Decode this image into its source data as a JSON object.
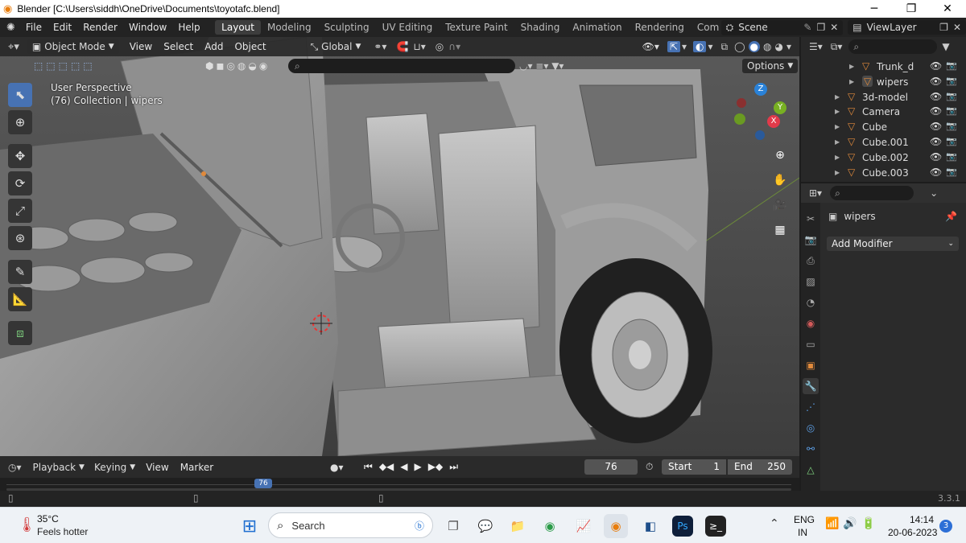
{
  "window": {
    "title": "Blender [C:\\Users\\siddh\\OneDrive\\Documents\\toyotafc.blend]",
    "minimize": "─",
    "maximize": "❐",
    "close": "✕"
  },
  "menu": {
    "items": [
      "File",
      "Edit",
      "Render",
      "Window",
      "Help"
    ]
  },
  "workspaces": [
    "Layout",
    "Modeling",
    "Sculpting",
    "UV Editing",
    "Texture Paint",
    "Shading",
    "Animation",
    "Rendering",
    "Compo"
  ],
  "scene": {
    "label": "Scene",
    "view_layer": "ViewLayer"
  },
  "viewport_header": {
    "mode": "Object Mode",
    "menus": [
      "View",
      "Select",
      "Add",
      "Object"
    ],
    "transform_orientation": "Global",
    "options": "Options"
  },
  "viewport_info": {
    "line1": "User Perspective",
    "line2": "(76) Collection | wipers"
  },
  "gizmo": {
    "z": "Z",
    "y": "Y",
    "x": "X"
  },
  "timeline": {
    "playback": "Playback",
    "keying": "Keying",
    "view": "View",
    "marker": "Marker",
    "current_frame": "76",
    "start_label": "Start",
    "start": "1",
    "end_label": "End",
    "end": "250"
  },
  "scrubber": {
    "current": "76"
  },
  "outliner": {
    "items": [
      {
        "label": "Trunk_dc",
        "depth": 1,
        "visible": true
      },
      {
        "label": "wipers",
        "depth": 1,
        "visible": true,
        "selected": true
      },
      {
        "label": "3d-model",
        "depth": 0,
        "visible": true
      },
      {
        "label": "Camera",
        "depth": 0,
        "visible": true
      },
      {
        "label": "Cube",
        "depth": 0,
        "visible": true
      },
      {
        "label": "Cube.001",
        "depth": 0,
        "visible": true
      },
      {
        "label": "Cube.002",
        "depth": 0,
        "visible": true
      },
      {
        "label": "Cube.003",
        "depth": 0,
        "visible": true
      }
    ]
  },
  "properties": {
    "object_name": "wipers",
    "add_modifier": "Add Modifier"
  },
  "version": "3.3.1",
  "taskbar": {
    "weather_temp": "35°C",
    "weather_text": "Feels hotter",
    "search_placeholder": "Search",
    "lang_line1": "ENG",
    "lang_line2": "IN",
    "time": "14:14",
    "date": "20-06-2023",
    "notifications": "3"
  }
}
